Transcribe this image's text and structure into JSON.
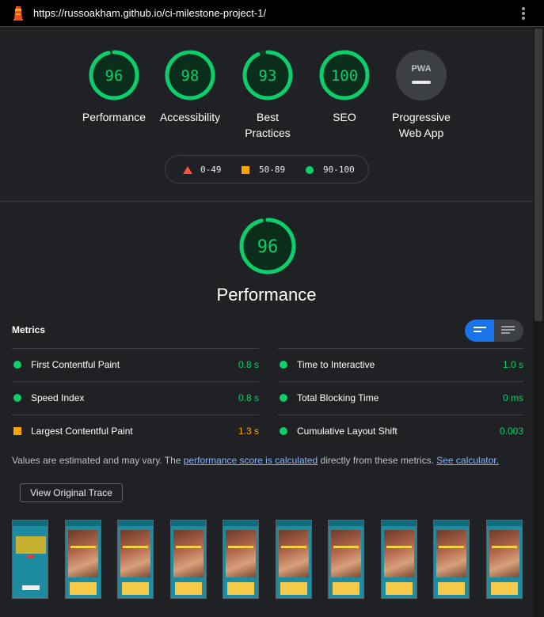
{
  "topbar": {
    "logo_icon": "lighthouse-icon",
    "url": "https://russoakham.github.io/ci-milestone-project-1/",
    "menu_icon": "kebab-menu-icon"
  },
  "colors": {
    "pass": "#0cce6b",
    "average": "#ffa400",
    "fail": "#ff4e42",
    "accent": "#1a73e8",
    "background": "#202124"
  },
  "categories": [
    {
      "label": "Performance",
      "score": "96",
      "score_value": 96
    },
    {
      "label": "Accessibility",
      "score": "98",
      "score_value": 98
    },
    {
      "label": "Best Practices",
      "score": "93",
      "score_value": 93
    },
    {
      "label": "SEO",
      "score": "100",
      "score_value": 100
    },
    {
      "label": "Progressive Web App",
      "badge_text": "PWA",
      "icon": "pwa-badge-icon"
    }
  ],
  "legend": [
    {
      "range": "0-49",
      "shape": "triangle",
      "color": "#ff4e42"
    },
    {
      "range": "50-89",
      "shape": "square",
      "color": "#ffa400"
    },
    {
      "range": "90-100",
      "shape": "circle",
      "color": "#0cce6b"
    }
  ],
  "performance": {
    "score": "96",
    "score_value": 96,
    "title": "Performance"
  },
  "metrics": {
    "heading": "Metrics",
    "toggle_icon_left": "expanded-view-icon",
    "toggle_icon_right": "list-view-icon",
    "left": [
      {
        "name": "First Contentful Paint",
        "value": "0.8 s",
        "status": "pass"
      },
      {
        "name": "Speed Index",
        "value": "0.8 s",
        "status": "pass"
      },
      {
        "name": "Largest Contentful Paint",
        "value": "1.3 s",
        "status": "average"
      }
    ],
    "right": [
      {
        "name": "Time to Interactive",
        "value": "1.0 s",
        "status": "pass"
      },
      {
        "name": "Total Blocking Time",
        "value": "0 ms",
        "status": "pass"
      },
      {
        "name": "Cumulative Layout Shift",
        "value": "0.003",
        "status": "pass"
      }
    ]
  },
  "disclaimer": {
    "prefix": "Values are estimated and may vary. The ",
    "link1": "performance score is calculated",
    "middle": " directly from these metrics. ",
    "link2": "See calculator."
  },
  "trace_button": "View Original Trace",
  "filmstrip": {
    "frame_count": 10,
    "frame_caption": "The Best Wings in Britain!"
  }
}
